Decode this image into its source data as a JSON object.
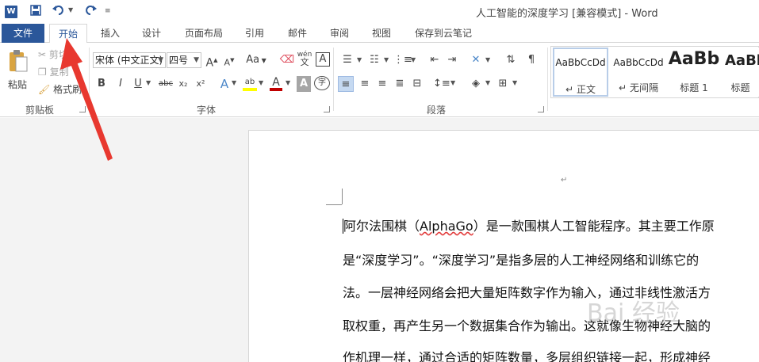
{
  "titlebar": {
    "app_icon": "W",
    "title": "人工智能的深度学习 [兼容模式] - Word",
    "quick_access": {
      "save_icon": "save-icon",
      "undo_icon": "undo-icon",
      "redo_icon": "redo-icon",
      "customize_icon": "customize-icon"
    }
  },
  "tabs": {
    "file": "文件",
    "items": [
      "开始",
      "插入",
      "设计",
      "页面布局",
      "引用",
      "邮件",
      "审阅",
      "视图",
      "保存到云笔记"
    ]
  },
  "clipboard": {
    "paste": "粘贴",
    "cut": "剪切",
    "copy": "复制",
    "format_painter": "格式刷",
    "label": "剪贴板"
  },
  "font": {
    "font_name": "宋体 (中文正文)",
    "font_size": "四号",
    "grow": "A",
    "shrink": "A",
    "change_case": "Aa",
    "phonetic": "wén",
    "phonetic_char": "文",
    "enclose": "A",
    "bold": "B",
    "italic": "I",
    "underline": "U",
    "strike": "abc",
    "subscript": "x₂",
    "superscript": "x²",
    "text_effects": "A",
    "highlight": "ab",
    "font_color": "A",
    "shading": "A",
    "enclose_char": "字",
    "label": "字体"
  },
  "paragraph": {
    "label": "段落"
  },
  "styles": {
    "items": [
      {
        "sample": "AaBbCcDd",
        "name": "正文"
      },
      {
        "sample": "AaBbCcDd",
        "name": "无间隔"
      },
      {
        "sample": "AaBb",
        "name": "标题 1"
      },
      {
        "sample": "AaBl",
        "name": "标题"
      }
    ],
    "bullet": "↵"
  },
  "document": {
    "paragraph_mark": "↵",
    "lines": [
      {
        "before": "阿尔法围棋（",
        "alpha": "AlphaGo",
        "after": "）是一款围棋人工智能程序。其主要工作原"
      },
      {
        "text": "是“深度学习”。“深度学习”是指多层的人工神经网络和训练它的"
      },
      {
        "text": "法。一层神经网络会把大量矩阵数字作为输入，通过非线性激活方"
      },
      {
        "text": "取权重，再产生另一个数据集合作为输出。这就像生物神经大脑的"
      },
      {
        "text": "作机理一样，通过合适的矩阵数量，多层组织链接一起，形成神经"
      }
    ]
  },
  "watermark": "Bai 经验",
  "colors": {
    "word_blue": "#2b579a",
    "arrow_red": "#e8382f",
    "highlight_yellow": "#ffff00",
    "font_color_red": "#c00000"
  }
}
